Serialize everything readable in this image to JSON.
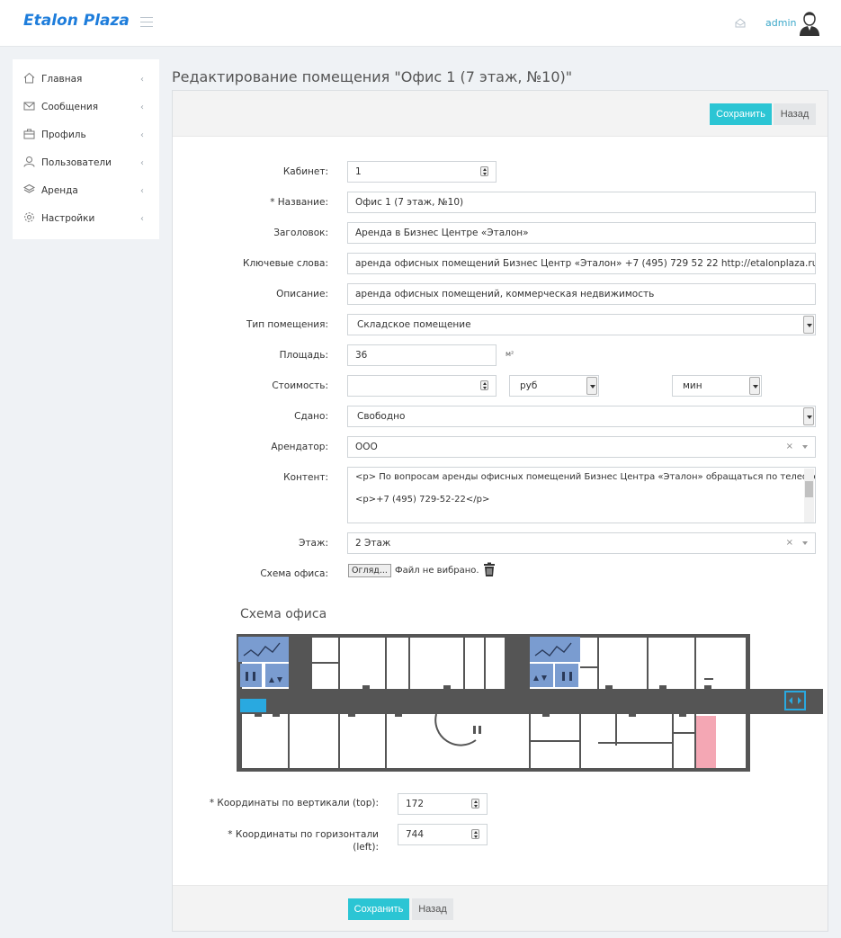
{
  "header": {
    "brand": "Etalon Plaza",
    "user": "admin"
  },
  "sidebar": {
    "items": [
      {
        "label": "Главная",
        "icon": "home-icon"
      },
      {
        "label": "Сообщения",
        "icon": "envelope-icon"
      },
      {
        "label": "Профиль",
        "icon": "briefcase-icon"
      },
      {
        "label": "Пользователи",
        "icon": "user-icon"
      },
      {
        "label": "Аренда",
        "icon": "layers-icon"
      },
      {
        "label": "Настройки",
        "icon": "gear-icon"
      }
    ]
  },
  "page": {
    "title": "Редактирование помещения \"Офис 1 (7 этаж, №10)\""
  },
  "actions": {
    "save": "Сохранить",
    "back": "Назад"
  },
  "form": {
    "cabinet": {
      "label": "Кабинет:",
      "value": "1"
    },
    "name": {
      "label": "* Название:",
      "value": "Офис 1 (7 этаж, №10)"
    },
    "heading": {
      "label": "Заголовок:",
      "value": "Аренда в Бизнес Центре «Эталон»"
    },
    "keywords": {
      "label": "Ключевые слова:",
      "value": "аренда офисных помещений Бизнес Центр «Эталон» +7 (495) 729 52 22 http://etalonplaza.ru коммерческая"
    },
    "description": {
      "label": "Описание:",
      "value": "аренда офисных помещений, коммерческая недвижимость"
    },
    "room_type": {
      "label": "Тип помещения:",
      "value": "Складское помещение"
    },
    "area": {
      "label": "Площадь:",
      "value": "36",
      "unit": "м²"
    },
    "cost": {
      "label": "Стоимость:",
      "value": "",
      "currency": "руб",
      "period": "мин"
    },
    "rented": {
      "label": "Сдано:",
      "value": "Свободно"
    },
    "tenant": {
      "label": "Арендатор:",
      "value": "ООО"
    },
    "content": {
      "label": "Контент:",
      "line1": "<p>  По вопросам аренды офисных помещений Бизнес Центра «Эталон» обращаться по телефону:</p>",
      "line2": "<p>+7 (495) 729-52-22</p>"
    },
    "floor": {
      "label": "Этаж:",
      "value": "2 Этаж"
    },
    "scheme": {
      "label": "Схема офиса:",
      "button": "Огляд...",
      "status": "Файл не вибрано."
    },
    "top": {
      "label": "* Координаты по вертикали (top):",
      "value": "172"
    },
    "left": {
      "label1": "* Координаты по горизонтали",
      "label2": "(left):",
      "value": "744"
    }
  },
  "schema_title": "Схема офиса",
  "colors": {
    "accent": "#2bc5d4",
    "brand": "#1e7ddb",
    "wall": "#555555",
    "stairs": "#7a9cd0",
    "highlight": "#f4a7b4",
    "marker": "#29a9e0"
  }
}
